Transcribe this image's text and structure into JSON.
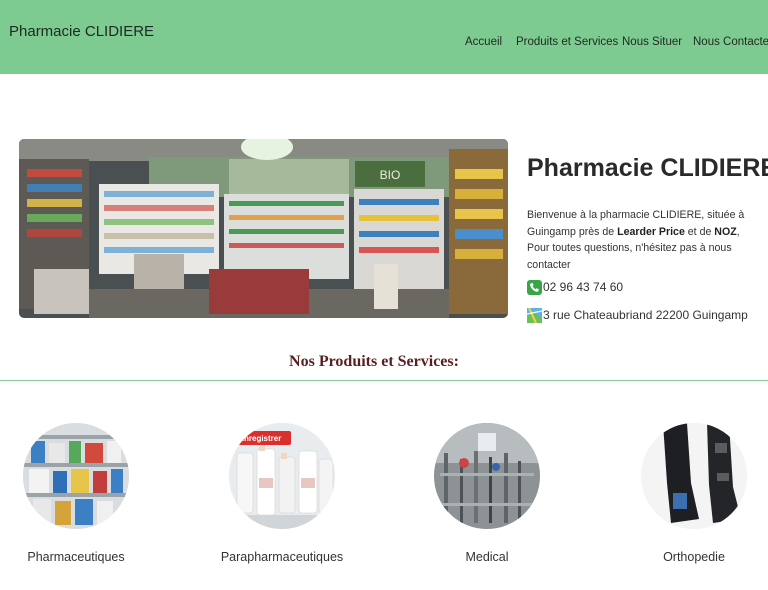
{
  "header": {
    "brand": "Pharmacie CLIDIERE",
    "nav": [
      {
        "label": "Accueil"
      },
      {
        "label": "Produits et Services"
      },
      {
        "label": "Nous Situer"
      },
      {
        "label": "Nous Contacter"
      }
    ],
    "color": "#7dcb90"
  },
  "hero": {
    "title": "Pharmacie CLIDIERE",
    "intro_prefix": "Bienvenue à la pharmacie CLIDIERE, située à Guingamp près de ",
    "store1": "Learder Price",
    "intro_mid": " et de ",
    "store2": "NOZ",
    "intro_suffix": ", Pour toutes questions, n'hésitez pas à nous contacter",
    "photo_icon": "pharmacy-interior-photo",
    "photo_sign": "BIO"
  },
  "contact": {
    "phone": "02 96 43 74 60",
    "phone_icon": "phone-icon",
    "address": "3 rue Chateaubriand 22200 Guingamp",
    "address_icon": "map-icon"
  },
  "products": {
    "title": "Nos Produits et Services:",
    "items": [
      {
        "label": "Pharmaceutiques",
        "image": "medicine-shelf-photo"
      },
      {
        "label": "Parapharmaceutiques",
        "image": "skincare-bottles-photo",
        "badge": "Enregistrer"
      },
      {
        "label": "Medical",
        "image": "medical-equipment-photo"
      },
      {
        "label": "Orthopedie",
        "image": "orthopedic-brace-photo"
      }
    ]
  }
}
